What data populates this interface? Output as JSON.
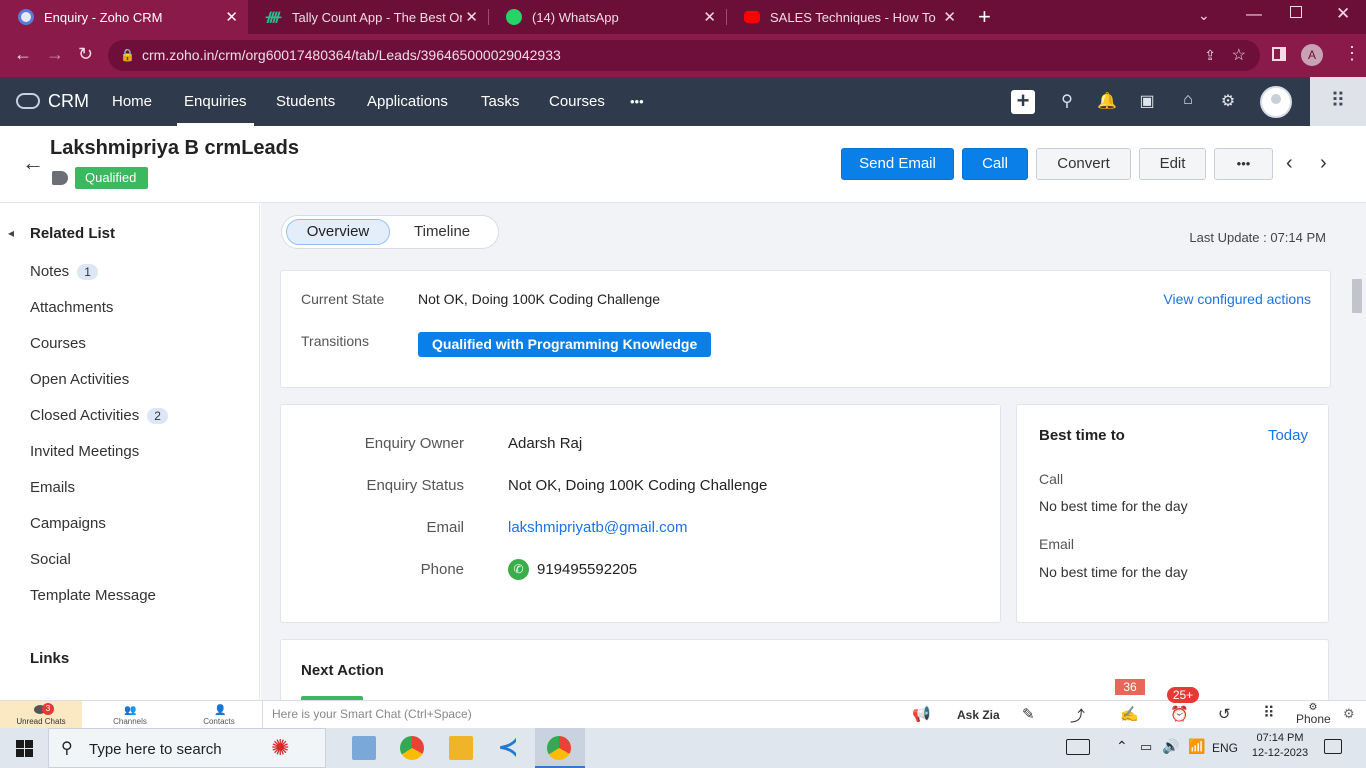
{
  "browser": {
    "tabs": [
      {
        "title": "Enquiry - Zoho CRM",
        "icon": "zoho-icon",
        "color": "#e8eaf3",
        "active": true
      },
      {
        "title": "Tally Count App - The Best Onlin",
        "icon": "tally-icon",
        "color": "#2bbf8f"
      },
      {
        "title": "(14) WhatsApp",
        "icon": "whatsapp-icon",
        "color": "#25d366"
      },
      {
        "title": "SALES Techniques - How To Con",
        "icon": "youtube-icon",
        "color": "#ff0000"
      }
    ],
    "url": "crm.zoho.in/crm/org60017480364/tab/Leads/396465000029042933",
    "profile_initial": "A"
  },
  "crm": {
    "logo": "CRM",
    "nav": [
      "Home",
      "Enquiries",
      "Students",
      "Applications",
      "Tasks",
      "Courses"
    ],
    "nav_active": "Enquiries",
    "more": "•••"
  },
  "record": {
    "name": "Lakshmipriya B crmLeads",
    "tag": "Qualified",
    "buttons": {
      "send_email": "Send Email",
      "call": "Call",
      "convert": "Convert",
      "edit": "Edit",
      "more": "•••"
    }
  },
  "related": {
    "title": "Related List",
    "items": [
      {
        "label": "Notes",
        "count": "1"
      },
      {
        "label": "Attachments"
      },
      {
        "label": "Courses"
      },
      {
        "label": "Open Activities"
      },
      {
        "label": "Closed Activities",
        "count": "2"
      },
      {
        "label": "Invited Meetings"
      },
      {
        "label": "Emails"
      },
      {
        "label": "Campaigns"
      },
      {
        "label": "Social"
      },
      {
        "label": "Template Message"
      }
    ],
    "links_title": "Links"
  },
  "main": {
    "tabs": [
      "Overview",
      "Timeline"
    ],
    "last_update": "Last Update : 07:14 PM",
    "blueprint": {
      "current_state_label": "Current State",
      "current_state": "Not OK, Doing 100K Coding Challenge",
      "view_actions": "View configured actions",
      "transitions_label": "Transitions",
      "transition_button": "Qualified with Programming Knowledge"
    },
    "fields": [
      {
        "label": "Enquiry Owner",
        "value": "Adarsh Raj"
      },
      {
        "label": "Enquiry Status",
        "value": "Not OK, Doing 100K Coding Challenge"
      },
      {
        "label": "Email",
        "value": "lakshmipriyatb@gmail.com"
      },
      {
        "label": "Phone",
        "value": "919495592205"
      }
    ],
    "best_time": {
      "title": "Best time to",
      "today": "Today",
      "call_label": "Call",
      "call_value": "No best time for the day",
      "email_label": "Email",
      "email_value": "No best time for the day"
    },
    "next_action": "Next Action"
  },
  "chatbar": {
    "unread_chats": "Unread Chats",
    "unread_count": "3",
    "channels": "Channels",
    "contacts": "Contacts",
    "placeholder": "Here is your Smart Chat (Ctrl+Space)",
    "ask_zia": "Ask Zia",
    "badge_36": "36",
    "badge_25": "25+",
    "phone": "Phone"
  },
  "taskbar": {
    "search": "Type here to search",
    "lang": "ENG",
    "time": "07:14 PM",
    "date": "12-12-2023"
  }
}
